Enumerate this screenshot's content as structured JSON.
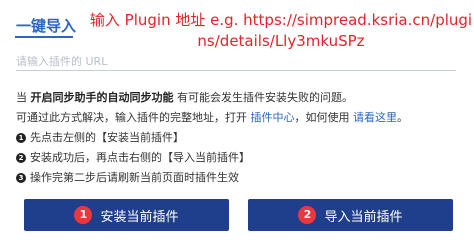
{
  "header": {
    "title": "一键导入"
  },
  "annotation": {
    "text": "输入 Plugin 地址 e.g. https://simpread.ksria.cn/plugins/details/Lly3mkuSPz"
  },
  "input": {
    "placeholder": "请输入插件的 URL",
    "value": ""
  },
  "info": {
    "line1_prefix": "当 ",
    "line1_bold": "开启同步助手的自动同步功能",
    "line1_suffix": " 有可能会发生插件安装失败的问题。",
    "line2_prefix": "可通过此方式解决，输入插件的完整地址，打开 ",
    "line2_link1": "插件中心",
    "line2_mid": "，如何使用 ",
    "line2_link2": "请看这里",
    "line2_suffix": "。",
    "steps": [
      {
        "num": "1",
        "text": "先点击左侧的【安装当前插件】"
      },
      {
        "num": "2",
        "text": "安装成功后，再点击右侧的【导入当前插件】"
      },
      {
        "num": "3",
        "text": "操作完第二步后请刷新当前页面时插件生效"
      }
    ]
  },
  "buttons": {
    "install": {
      "badge": "1",
      "label": "安装当前插件"
    },
    "import": {
      "badge": "2",
      "label": "导入当前插件"
    }
  },
  "colors": {
    "accent": "#2a67c3",
    "button_bg": "#1f3f8c",
    "badge_red": "#e9373d",
    "annotation_red": "#e8222a"
  }
}
